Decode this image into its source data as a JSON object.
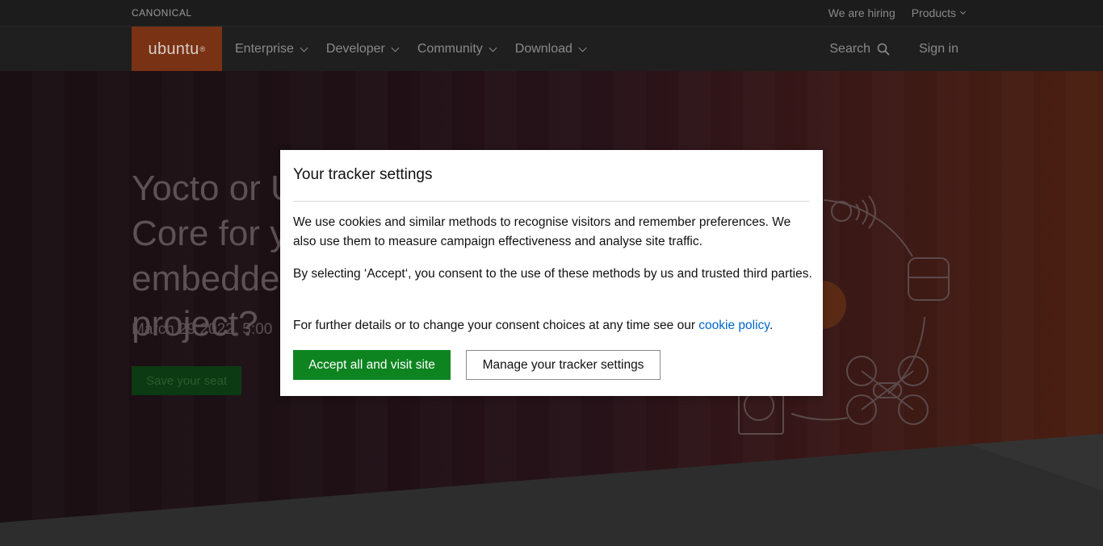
{
  "global_bar": {
    "brand": "CANONICAL",
    "hiring_label": "We are hiring",
    "products_label": "Products"
  },
  "nav": {
    "logo_text": "ubuntu",
    "logo_mark": "®",
    "items": [
      {
        "label": "Enterprise"
      },
      {
        "label": "Developer"
      },
      {
        "label": "Community"
      },
      {
        "label": "Download"
      }
    ],
    "search_label": "Search",
    "signin_label": "Sign in"
  },
  "hero": {
    "title": "Yocto or Ubuntu Core for your embedded Linux project?",
    "date": "March 29 2022, 5:00",
    "cta_label": "Save your seat"
  },
  "modal": {
    "title": "Your tracker settings",
    "paragraph1": "We use cookies and similar methods to recognise visitors and remember preferences. We also use them to measure campaign effectiveness and analyse site traffic.",
    "paragraph2": "By selecting ‘Accept‘, you consent to the use of these methods by us and trusted third parties.",
    "paragraph3_prefix": "For further details or to change your consent choices at any time see our ",
    "paragraph3_link": "cookie policy",
    "paragraph3_suffix": ".",
    "accept_label": "Accept all and visit site",
    "manage_label": "Manage your tracker settings"
  },
  "colors": {
    "accent_green": "#0e8420",
    "link_blue": "#0066cc",
    "ubuntu_orange_dim": "#7a3214"
  },
  "icons": [
    "chevron-down-icon",
    "search-icon",
    "canonical-dot-icon"
  ]
}
